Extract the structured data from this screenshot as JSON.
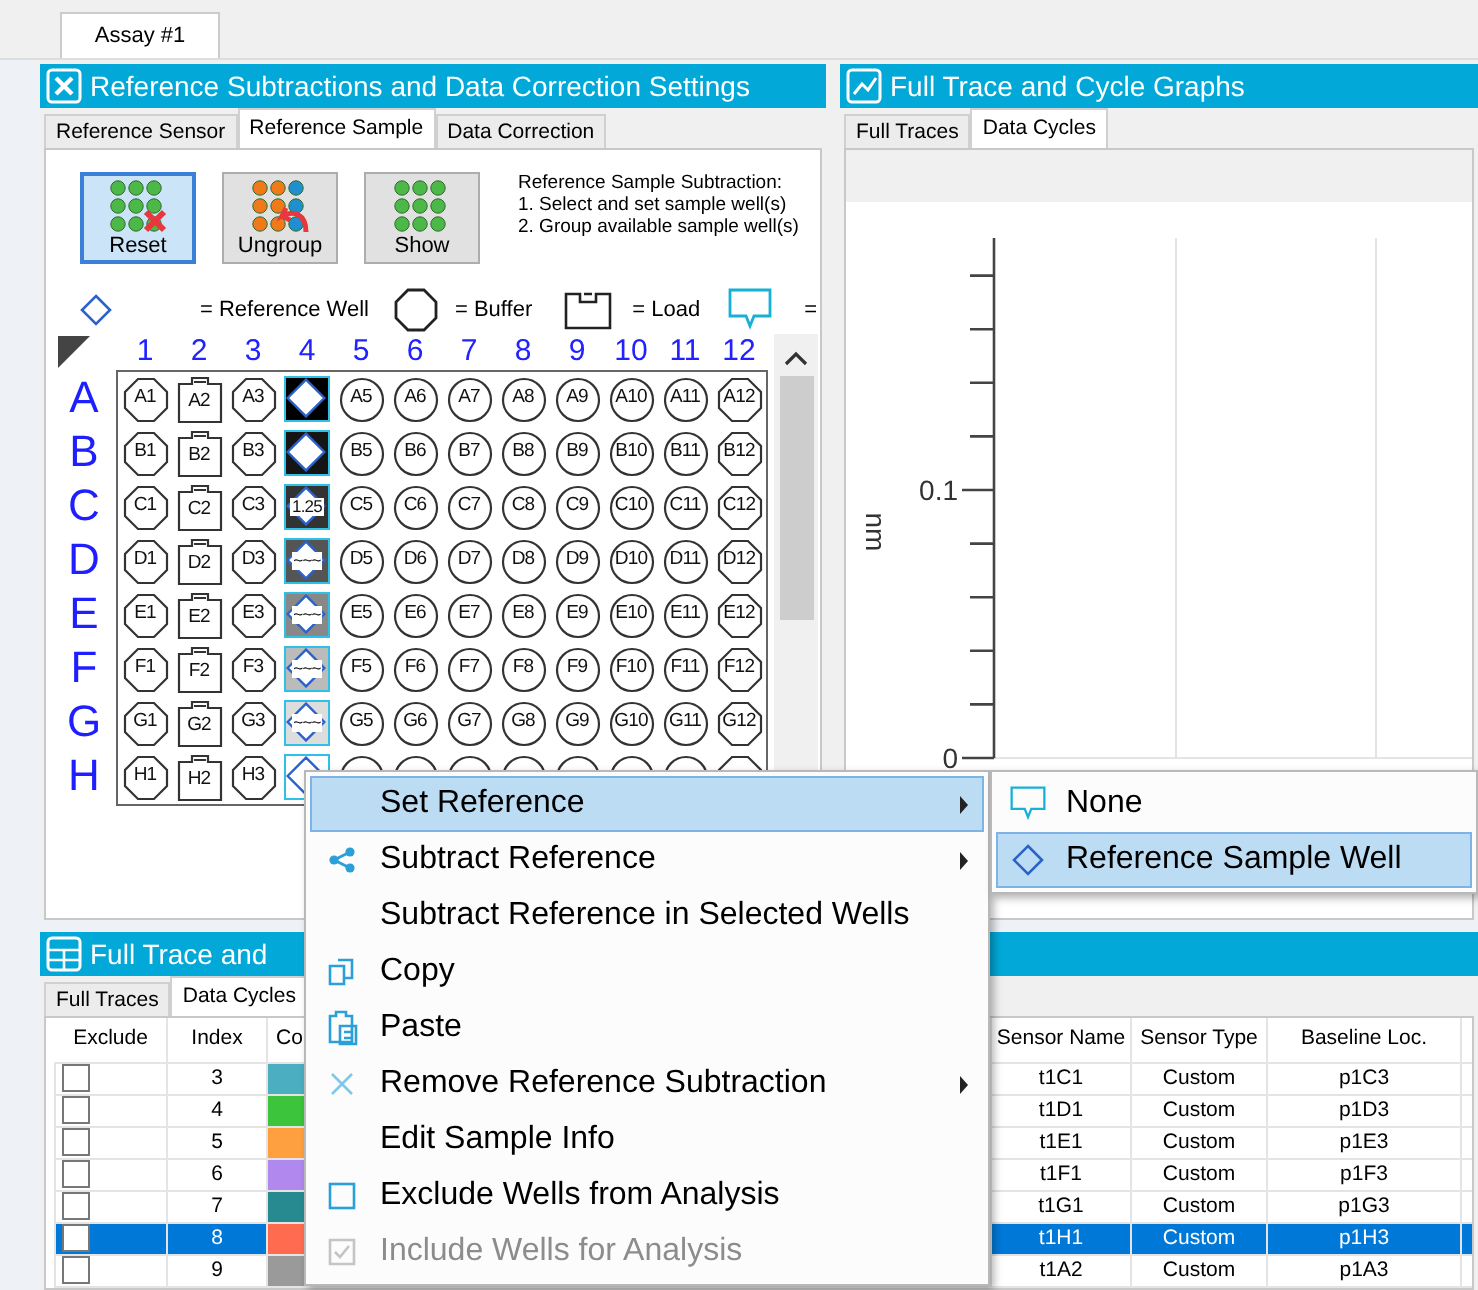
{
  "document_tab": {
    "label": "Assay #1",
    "selected": true
  },
  "settings_panel": {
    "title": "Reference Subtractions and Data Correction Settings",
    "tabs": [
      {
        "label": "Reference Sensor",
        "selected": false
      },
      {
        "label": "Reference Sample",
        "selected": true
      },
      {
        "label": "Data Correction",
        "selected": false
      }
    ],
    "toolbar": [
      {
        "label": "Reset",
        "kind": "reset",
        "selected": true
      },
      {
        "label": "Ungroup",
        "kind": "ungroup",
        "selected": false
      },
      {
        "label": "Show",
        "kind": "show",
        "selected": false
      }
    ],
    "instructions": [
      "Reference Sample Subtraction:",
      "1.  Select and set sample well(s)",
      "2.  Group available sample well(s)"
    ],
    "legend": [
      {
        "kind": "reference",
        "label": "= Reference Well"
      },
      {
        "kind": "buffer",
        "label": "= Buffer"
      },
      {
        "kind": "load",
        "label": "= Load"
      },
      {
        "kind": "sensor",
        "label": "="
      }
    ],
    "plate": {
      "columns": [
        "1",
        "2",
        "3",
        "4",
        "5",
        "6",
        "7",
        "8",
        "9",
        "10",
        "11",
        "12"
      ],
      "rows": [
        {
          "label": "A",
          "wells": [
            {
              "kind": "buffer",
              "label": "A1"
            },
            {
              "kind": "load",
              "label": "A2"
            },
            {
              "kind": "buffer",
              "label": "A3"
            },
            {
              "kind": "reference",
              "color": "#000000"
            },
            {
              "kind": "sample",
              "label": "A5"
            },
            {
              "kind": "sample",
              "label": "A6"
            },
            {
              "kind": "sample",
              "label": "A7"
            },
            {
              "kind": "sample",
              "label": "A8"
            },
            {
              "kind": "sample",
              "label": "A9"
            },
            {
              "kind": "sample",
              "label": "A10"
            },
            {
              "kind": "sample",
              "label": "A11"
            },
            {
              "kind": "buffer",
              "label": "A12"
            }
          ]
        },
        {
          "label": "B",
          "wells": [
            {
              "kind": "buffer",
              "label": "B1"
            },
            {
              "kind": "load",
              "label": "B2"
            },
            {
              "kind": "buffer",
              "label": "B3"
            },
            {
              "kind": "reference",
              "color": "#151515"
            },
            {
              "kind": "sample",
              "label": "B5"
            },
            {
              "kind": "sample",
              "label": "B6"
            },
            {
              "kind": "sample",
              "label": "B7"
            },
            {
              "kind": "sample",
              "label": "B8"
            },
            {
              "kind": "sample",
              "label": "B9"
            },
            {
              "kind": "sample",
              "label": "B10"
            },
            {
              "kind": "sample",
              "label": "B11"
            },
            {
              "kind": "buffer",
              "label": "B12"
            }
          ]
        },
        {
          "label": "C",
          "wells": [
            {
              "kind": "buffer",
              "label": "C1"
            },
            {
              "kind": "load",
              "label": "C2"
            },
            {
              "kind": "buffer",
              "label": "C3"
            },
            {
              "kind": "reference",
              "color": "#333333",
              "label": "1.25"
            },
            {
              "kind": "sample",
              "label": "C5"
            },
            {
              "kind": "sample",
              "label": "C6"
            },
            {
              "kind": "sample",
              "label": "C7"
            },
            {
              "kind": "sample",
              "label": "C8"
            },
            {
              "kind": "sample",
              "label": "C9"
            },
            {
              "kind": "sample",
              "label": "C10"
            },
            {
              "kind": "sample",
              "label": "C11"
            },
            {
              "kind": "buffer",
              "label": "C12"
            }
          ]
        },
        {
          "label": "D",
          "wells": [
            {
              "kind": "buffer",
              "label": "D1"
            },
            {
              "kind": "load",
              "label": "D2"
            },
            {
              "kind": "buffer",
              "label": "D3"
            },
            {
              "kind": "reference",
              "color": "#555555",
              "label": "~~~"
            },
            {
              "kind": "sample",
              "label": "D5"
            },
            {
              "kind": "sample",
              "label": "D6"
            },
            {
              "kind": "sample",
              "label": "D7"
            },
            {
              "kind": "sample",
              "label": "D8"
            },
            {
              "kind": "sample",
              "label": "D9"
            },
            {
              "kind": "sample",
              "label": "D10"
            },
            {
              "kind": "sample",
              "label": "D11"
            },
            {
              "kind": "buffer",
              "label": "D12"
            }
          ]
        },
        {
          "label": "E",
          "wells": [
            {
              "kind": "buffer",
              "label": "E1"
            },
            {
              "kind": "load",
              "label": "E2"
            },
            {
              "kind": "buffer",
              "label": "E3"
            },
            {
              "kind": "reference",
              "color": "#888888",
              "label": "~~~"
            },
            {
              "kind": "sample",
              "label": "E5"
            },
            {
              "kind": "sample",
              "label": "E6"
            },
            {
              "kind": "sample",
              "label": "E7"
            },
            {
              "kind": "sample",
              "label": "E8"
            },
            {
              "kind": "sample",
              "label": "E9"
            },
            {
              "kind": "sample",
              "label": "E10"
            },
            {
              "kind": "sample",
              "label": "E11"
            },
            {
              "kind": "buffer",
              "label": "E12"
            }
          ]
        },
        {
          "label": "F",
          "wells": [
            {
              "kind": "buffer",
              "label": "F1"
            },
            {
              "kind": "load",
              "label": "F2"
            },
            {
              "kind": "buffer",
              "label": "F3"
            },
            {
              "kind": "reference",
              "color": "#bbbbbb",
              "label": "~~~"
            },
            {
              "kind": "sample",
              "label": "F5"
            },
            {
              "kind": "sample",
              "label": "F6"
            },
            {
              "kind": "sample",
              "label": "F7"
            },
            {
              "kind": "sample",
              "label": "F8"
            },
            {
              "kind": "sample",
              "label": "F9"
            },
            {
              "kind": "sample",
              "label": "F10"
            },
            {
              "kind": "sample",
              "label": "F11"
            },
            {
              "kind": "buffer",
              "label": "F12"
            }
          ]
        },
        {
          "label": "G",
          "wells": [
            {
              "kind": "buffer",
              "label": "G1"
            },
            {
              "kind": "load",
              "label": "G2"
            },
            {
              "kind": "buffer",
              "label": "G3"
            },
            {
              "kind": "reference",
              "color": "#dddddd",
              "label": "~~~"
            },
            {
              "kind": "sample",
              "label": "G5"
            },
            {
              "kind": "sample",
              "label": "G6"
            },
            {
              "kind": "sample",
              "label": "G7"
            },
            {
              "kind": "sample",
              "label": "G8"
            },
            {
              "kind": "sample",
              "label": "G9"
            },
            {
              "kind": "sample",
              "label": "G10"
            },
            {
              "kind": "sample",
              "label": "G11"
            },
            {
              "kind": "buffer",
              "label": "G12"
            }
          ]
        },
        {
          "label": "H",
          "wells": [
            {
              "kind": "buffer",
              "label": "H1"
            },
            {
              "kind": "load",
              "label": "H2"
            },
            {
              "kind": "buffer",
              "label": "H3"
            },
            {
              "kind": "reference",
              "color": "#ffffff"
            },
            {
              "kind": "sample"
            },
            {
              "kind": "sample"
            },
            {
              "kind": "sample"
            },
            {
              "kind": "sample"
            },
            {
              "kind": "sample"
            },
            {
              "kind": "sample"
            },
            {
              "kind": "sample"
            },
            {
              "kind": "buffer"
            }
          ]
        }
      ]
    }
  },
  "graph_panel": {
    "title": "Full Trace and Cycle Graphs",
    "tabs": [
      {
        "label": "Full Traces",
        "selected": false
      },
      {
        "label": "Data Cycles",
        "selected": true
      }
    ],
    "plot": {
      "axis_title": "nm",
      "tick_labels": [
        "0.1",
        "0"
      ]
    }
  },
  "results_panel": {
    "title": "Full Trace and",
    "tabs": [
      {
        "label": "Full Traces",
        "selected": false
      },
      {
        "label": "Data Cycles",
        "selected": true
      }
    ],
    "table": {
      "columns": [
        "Exclude",
        "Index",
        "Co",
        "Sensor Name",
        "Sensor Type",
        "Baseline Loc."
      ],
      "rows": [
        {
          "excluded": false,
          "index": "3",
          "color": "#4bafc1",
          "sensor_name": "t1C1",
          "sensor_type": "Custom",
          "baseline_loc": "p1C3",
          "selected": false
        },
        {
          "excluded": false,
          "index": "4",
          "color": "#3cc43c",
          "sensor_name": "t1D1",
          "sensor_type": "Custom",
          "baseline_loc": "p1D3",
          "selected": false
        },
        {
          "excluded": false,
          "index": "5",
          "color": "#ffa040",
          "sensor_name": "t1E1",
          "sensor_type": "Custom",
          "baseline_loc": "p1E3",
          "selected": false
        },
        {
          "excluded": false,
          "index": "6",
          "color": "#b088ee",
          "sensor_name": "t1F1",
          "sensor_type": "Custom",
          "baseline_loc": "p1F3",
          "selected": false
        },
        {
          "excluded": false,
          "index": "7",
          "color": "#268a90",
          "sensor_name": "t1G1",
          "sensor_type": "Custom",
          "baseline_loc": "p1G3",
          "selected": false
        },
        {
          "excluded": false,
          "index": "8",
          "color": "#ff6b4f",
          "sensor_name": "t1H1",
          "sensor_type": "Custom",
          "baseline_loc": "p1H3",
          "selected": true
        },
        {
          "excluded": false,
          "index": "9",
          "color": "#9a9a9a",
          "sensor_name": "t1A2",
          "sensor_type": "Custom",
          "baseline_loc": "p1A3",
          "selected": false
        }
      ]
    }
  },
  "context_menu": {
    "items": [
      {
        "label": "Set Reference",
        "submenu": true,
        "disabled": false,
        "selected": true
      },
      {
        "label": "Subtract Reference",
        "kind": "share",
        "submenu": true,
        "disabled": false,
        "selected": false
      },
      {
        "label": "Subtract Reference in Selected Wells",
        "submenu": false,
        "disabled": false,
        "selected": false
      },
      {
        "label": "Copy",
        "kind": "copy",
        "submenu": false,
        "disabled": false,
        "selected": false
      },
      {
        "label": "Paste",
        "kind": "paste",
        "submenu": false,
        "disabled": false,
        "selected": false
      },
      {
        "label": "Remove Reference Subtraction",
        "kind": "remove",
        "submenu": true,
        "disabled": false,
        "selected": false
      },
      {
        "label": "Edit Sample Info",
        "submenu": false,
        "disabled": false,
        "selected": false
      },
      {
        "label": "Exclude Wells from Analysis",
        "kind": "square",
        "submenu": false,
        "disabled": false,
        "selected": false
      },
      {
        "label": "Include Wells for Analysis",
        "kind": "checkbox",
        "submenu": false,
        "disabled": true,
        "selected": false
      }
    ]
  },
  "submenu": {
    "items": [
      {
        "label": "None",
        "kind": "monitor",
        "selected": false
      },
      {
        "label": "Reference Sample Well",
        "kind": "diamond",
        "selected": true
      }
    ]
  }
}
